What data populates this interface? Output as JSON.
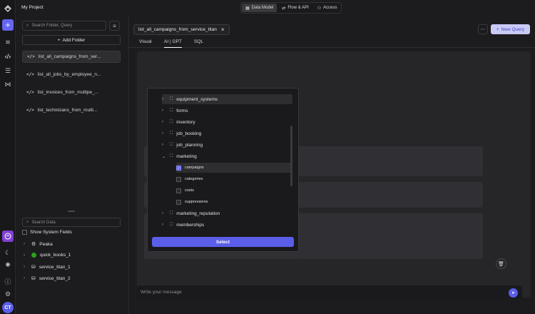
{
  "app": {
    "project_name": "My Project"
  },
  "top_tabs": [
    {
      "label": "Data Model",
      "icon": "table-icon",
      "active": true
    },
    {
      "label": "Flow & API",
      "icon": "flow-icon",
      "active": false
    },
    {
      "label": "Access",
      "icon": "users-icon",
      "active": false
    }
  ],
  "left_panel": {
    "search_placeholder": "Search Folder, Query",
    "add_folder_label": "Add Folder",
    "queries": [
      {
        "label": "list_all_campaigns_from_ser...",
        "active": true
      },
      {
        "label": "list_all_jobs_by_employee_n...",
        "active": false
      },
      {
        "label": "list_invoices_from_multipe_...",
        "active": false
      },
      {
        "label": "list_technicians_from_multi...",
        "active": false
      }
    ],
    "data_search_placeholder": "Search Data",
    "show_system_fields_label": "Show System Fields",
    "sources": [
      {
        "label": "Peaka",
        "icon": "peaka-icon"
      },
      {
        "label": "quick_books_1",
        "icon": "quickbooks-icon"
      },
      {
        "label": "service_titan_1",
        "icon": "database-icon"
      },
      {
        "label": "service_titan_2",
        "icon": "database-icon"
      }
    ]
  },
  "main": {
    "query_tab_label": "list_all_campaigns_from_service_titan",
    "new_query_label": "New Query",
    "sub_tabs": [
      {
        "label": "Visual",
        "active": false
      },
      {
        "label": "AI | GPT",
        "active": true
      },
      {
        "label": "SQL",
        "active": false
      }
    ],
    "message_placeholder": "Write your message"
  },
  "tree": {
    "items": [
      {
        "label": "equipment_systems",
        "type": "folder",
        "highlight": true
      },
      {
        "label": "forms",
        "type": "folder"
      },
      {
        "label": "inventory",
        "type": "folder"
      },
      {
        "label": "job_booking",
        "type": "folder"
      },
      {
        "label": "job_planning",
        "type": "folder"
      },
      {
        "label": "marketing",
        "type": "folder",
        "expanded": true
      },
      {
        "label": "campaigns",
        "type": "table",
        "checked": true,
        "highlight": true
      },
      {
        "label": "categories",
        "type": "table",
        "checked": false
      },
      {
        "label": "costs",
        "type": "table",
        "checked": false
      },
      {
        "label": "suppressions",
        "type": "table",
        "checked": false
      },
      {
        "label": "marketing_reputation",
        "type": "folder"
      },
      {
        "label": "memberships",
        "type": "folder"
      }
    ],
    "select_label": "Select"
  },
  "rail": {
    "avatar_initials": "CT"
  },
  "colors": {
    "accent": "#5b5ee8",
    "background": "#1c1c1e"
  }
}
